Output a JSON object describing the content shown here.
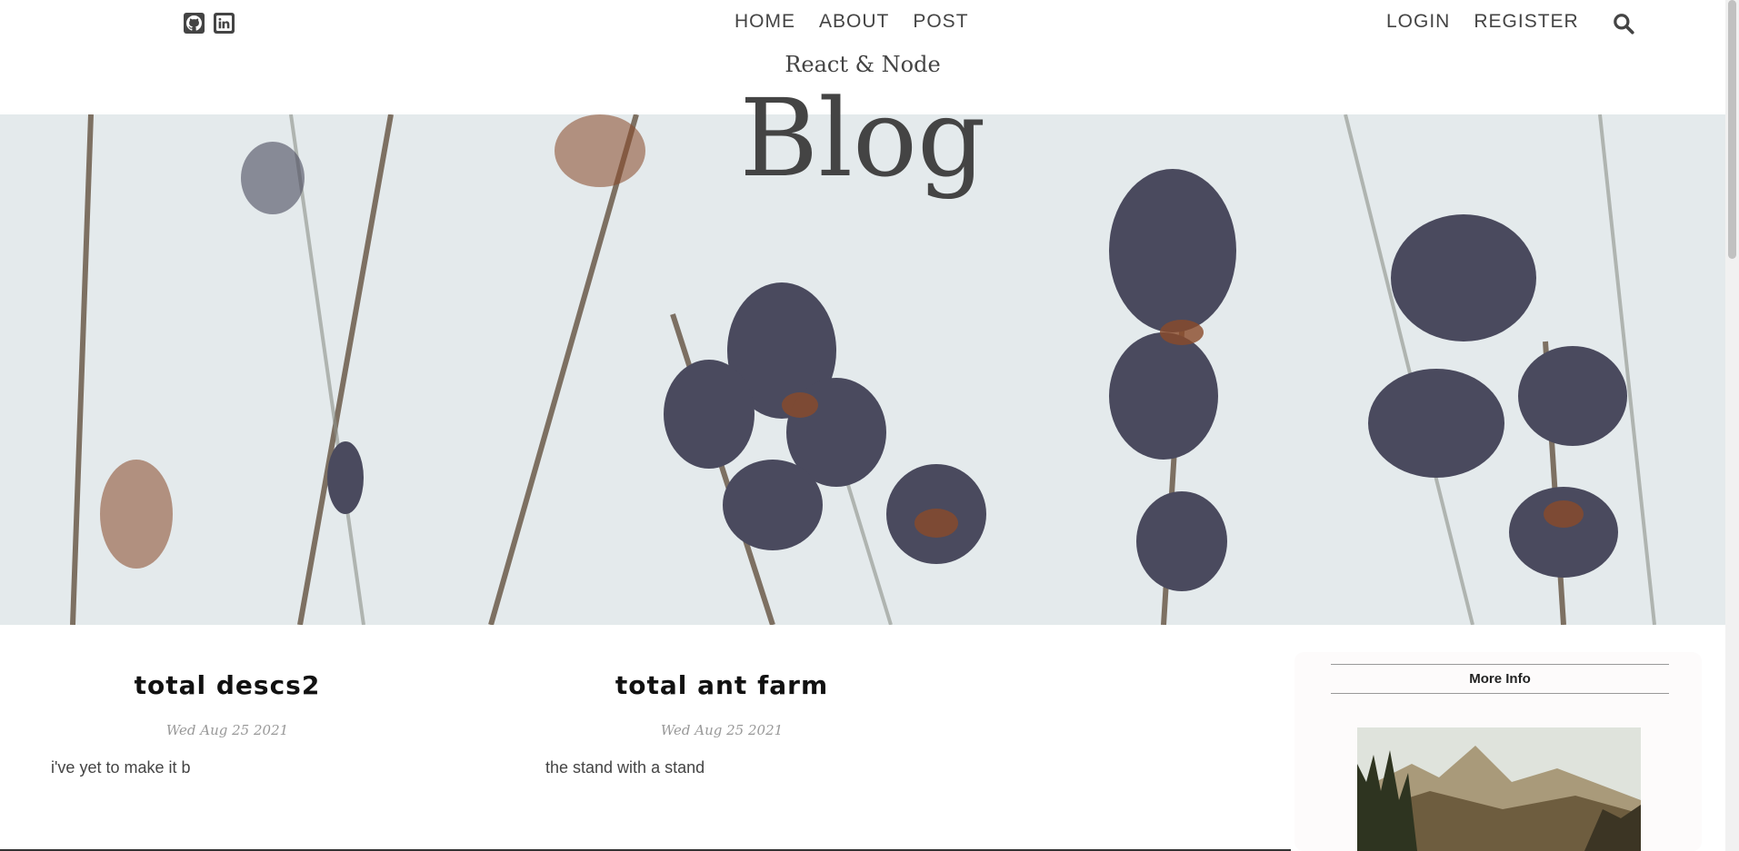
{
  "topbar": {
    "social": [
      {
        "icon": "github-icon"
      },
      {
        "icon": "linkedin-icon"
      }
    ],
    "nav_center": [
      "HOME",
      "ABOUT",
      "POST"
    ],
    "nav_right": [
      "LOGIN",
      "REGISTER"
    ]
  },
  "header": {
    "subtitle": "React & Node",
    "title": "Blog"
  },
  "posts": [
    {
      "title": "total descs2",
      "date": "Wed Aug 25 2021",
      "desc": "i've yet to make it b"
    },
    {
      "title": "total ant farm",
      "date": "Wed Aug 25 2021",
      "desc": "the stand with a stand"
    }
  ],
  "sidebar": {
    "title": "More Info"
  },
  "colors": {
    "text": "#444444",
    "title": "#111111",
    "date": "#999999",
    "hero_bg": "#e3e9eb"
  }
}
